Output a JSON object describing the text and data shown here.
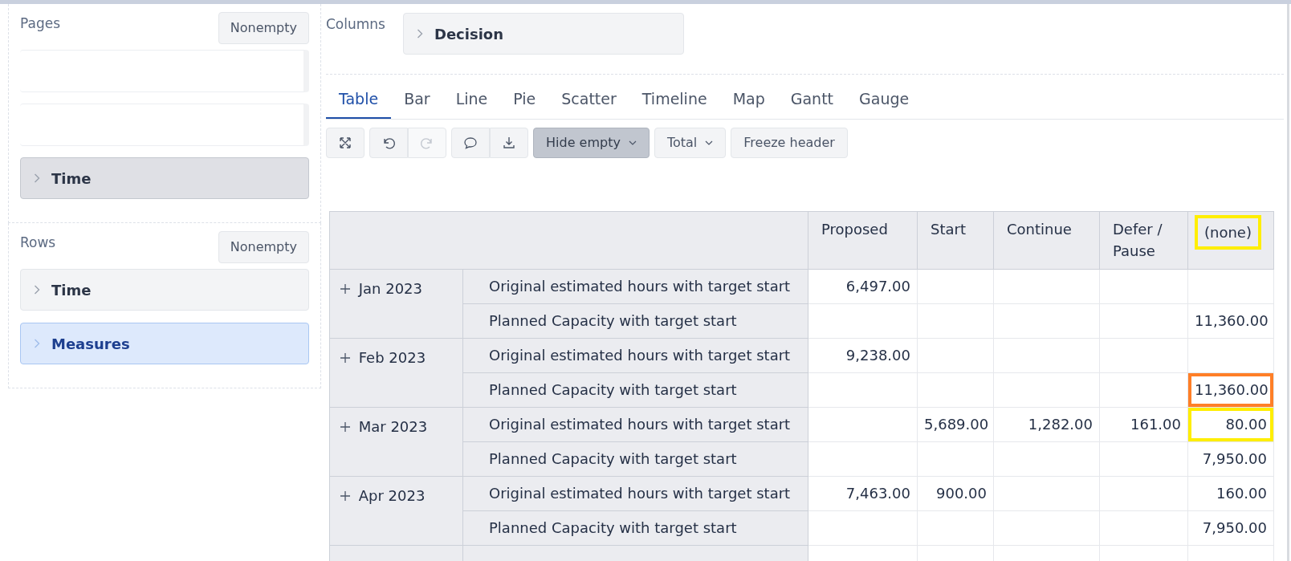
{
  "pages": {
    "title": "Pages",
    "nonempty_button": "Nonempty",
    "slots": [
      {
        "kind": "blank"
      },
      {
        "kind": "blank"
      }
    ],
    "items": [
      {
        "label": "Time",
        "kind": "muted"
      }
    ]
  },
  "rows_panel": {
    "title": "Rows",
    "nonempty_button": "Nonempty",
    "items": [
      {
        "label": "Time",
        "kind": "default"
      },
      {
        "label": "Measures",
        "kind": "highlighted"
      }
    ]
  },
  "columns_panel": {
    "title": "Columns",
    "items": [
      {
        "label": "Decision",
        "kind": "default"
      }
    ]
  },
  "tabs": [
    {
      "label": "Table",
      "selected": true
    },
    {
      "label": "Bar",
      "selected": false
    },
    {
      "label": "Line",
      "selected": false
    },
    {
      "label": "Pie",
      "selected": false
    },
    {
      "label": "Scatter",
      "selected": false
    },
    {
      "label": "Timeline",
      "selected": false
    },
    {
      "label": "Map",
      "selected": false
    },
    {
      "label": "Gantt",
      "selected": false
    },
    {
      "label": "Gauge",
      "selected": false
    }
  ],
  "toolbar": {
    "icon_groups": [
      [
        {
          "kind": "expand",
          "disabled": false
        }
      ],
      [
        {
          "kind": "undo",
          "disabled": false
        },
        {
          "kind": "redo",
          "disabled": true
        }
      ],
      [
        {
          "kind": "comment",
          "disabled": false
        },
        {
          "kind": "download",
          "disabled": false
        }
      ]
    ],
    "buttons": [
      {
        "label": "Hide empty",
        "dropdown": true,
        "active": true
      },
      {
        "label": "Total",
        "dropdown": true,
        "active": false
      },
      {
        "label": "Freeze header",
        "dropdown": false,
        "active": false
      }
    ]
  },
  "table": {
    "columns": [
      {
        "label": "Proposed"
      },
      {
        "label": "Start"
      },
      {
        "label": "Continue"
      },
      {
        "label": "Defer / Pause"
      },
      {
        "label": "(none)",
        "color": "#ffee00"
      }
    ],
    "groups": [
      {
        "label": "Jan 2023",
        "rows": [
          {
            "label": "Original estimated hours with target start",
            "cells": [
              {
                "text": "6,497.00"
              },
              null,
              null,
              null,
              null
            ]
          },
          {
            "label": "Planned Capacity with target start",
            "cells": [
              null,
              null,
              null,
              null,
              {
                "text": "11,360.00"
              }
            ]
          }
        ]
      },
      {
        "label": "Feb 2023",
        "rows": [
          {
            "label": "Original estimated hours with target start",
            "cells": [
              {
                "text": "9,238.00"
              },
              null,
              null,
              null,
              null
            ]
          },
          {
            "label": "Planned Capacity with target start",
            "cells": [
              null,
              null,
              null,
              null,
              {
                "text": "11,360.00",
                "color": "#ff7f27"
              }
            ]
          }
        ]
      },
      {
        "label": "Mar 2023",
        "rows": [
          {
            "label": "Original estimated hours with target start",
            "cells": [
              null,
              {
                "text": "5,689.00"
              },
              {
                "text": "1,282.00"
              },
              {
                "text": "161.00"
              },
              {
                "text": "80.00",
                "color": "#ffee00"
              }
            ]
          },
          {
            "label": "Planned Capacity with target start",
            "cells": [
              null,
              null,
              null,
              null,
              {
                "text": "7,950.00"
              }
            ]
          }
        ]
      },
      {
        "label": "Apr 2023",
        "rows": [
          {
            "label": "Original estimated hours with target start",
            "cells": [
              {
                "text": "7,463.00"
              },
              {
                "text": "900.00"
              },
              null,
              null,
              {
                "text": "160.00"
              }
            ]
          },
          {
            "label": "Planned Capacity with target start",
            "cells": [
              null,
              null,
              null,
              null,
              {
                "text": "7,950.00"
              }
            ]
          }
        ]
      }
    ]
  }
}
